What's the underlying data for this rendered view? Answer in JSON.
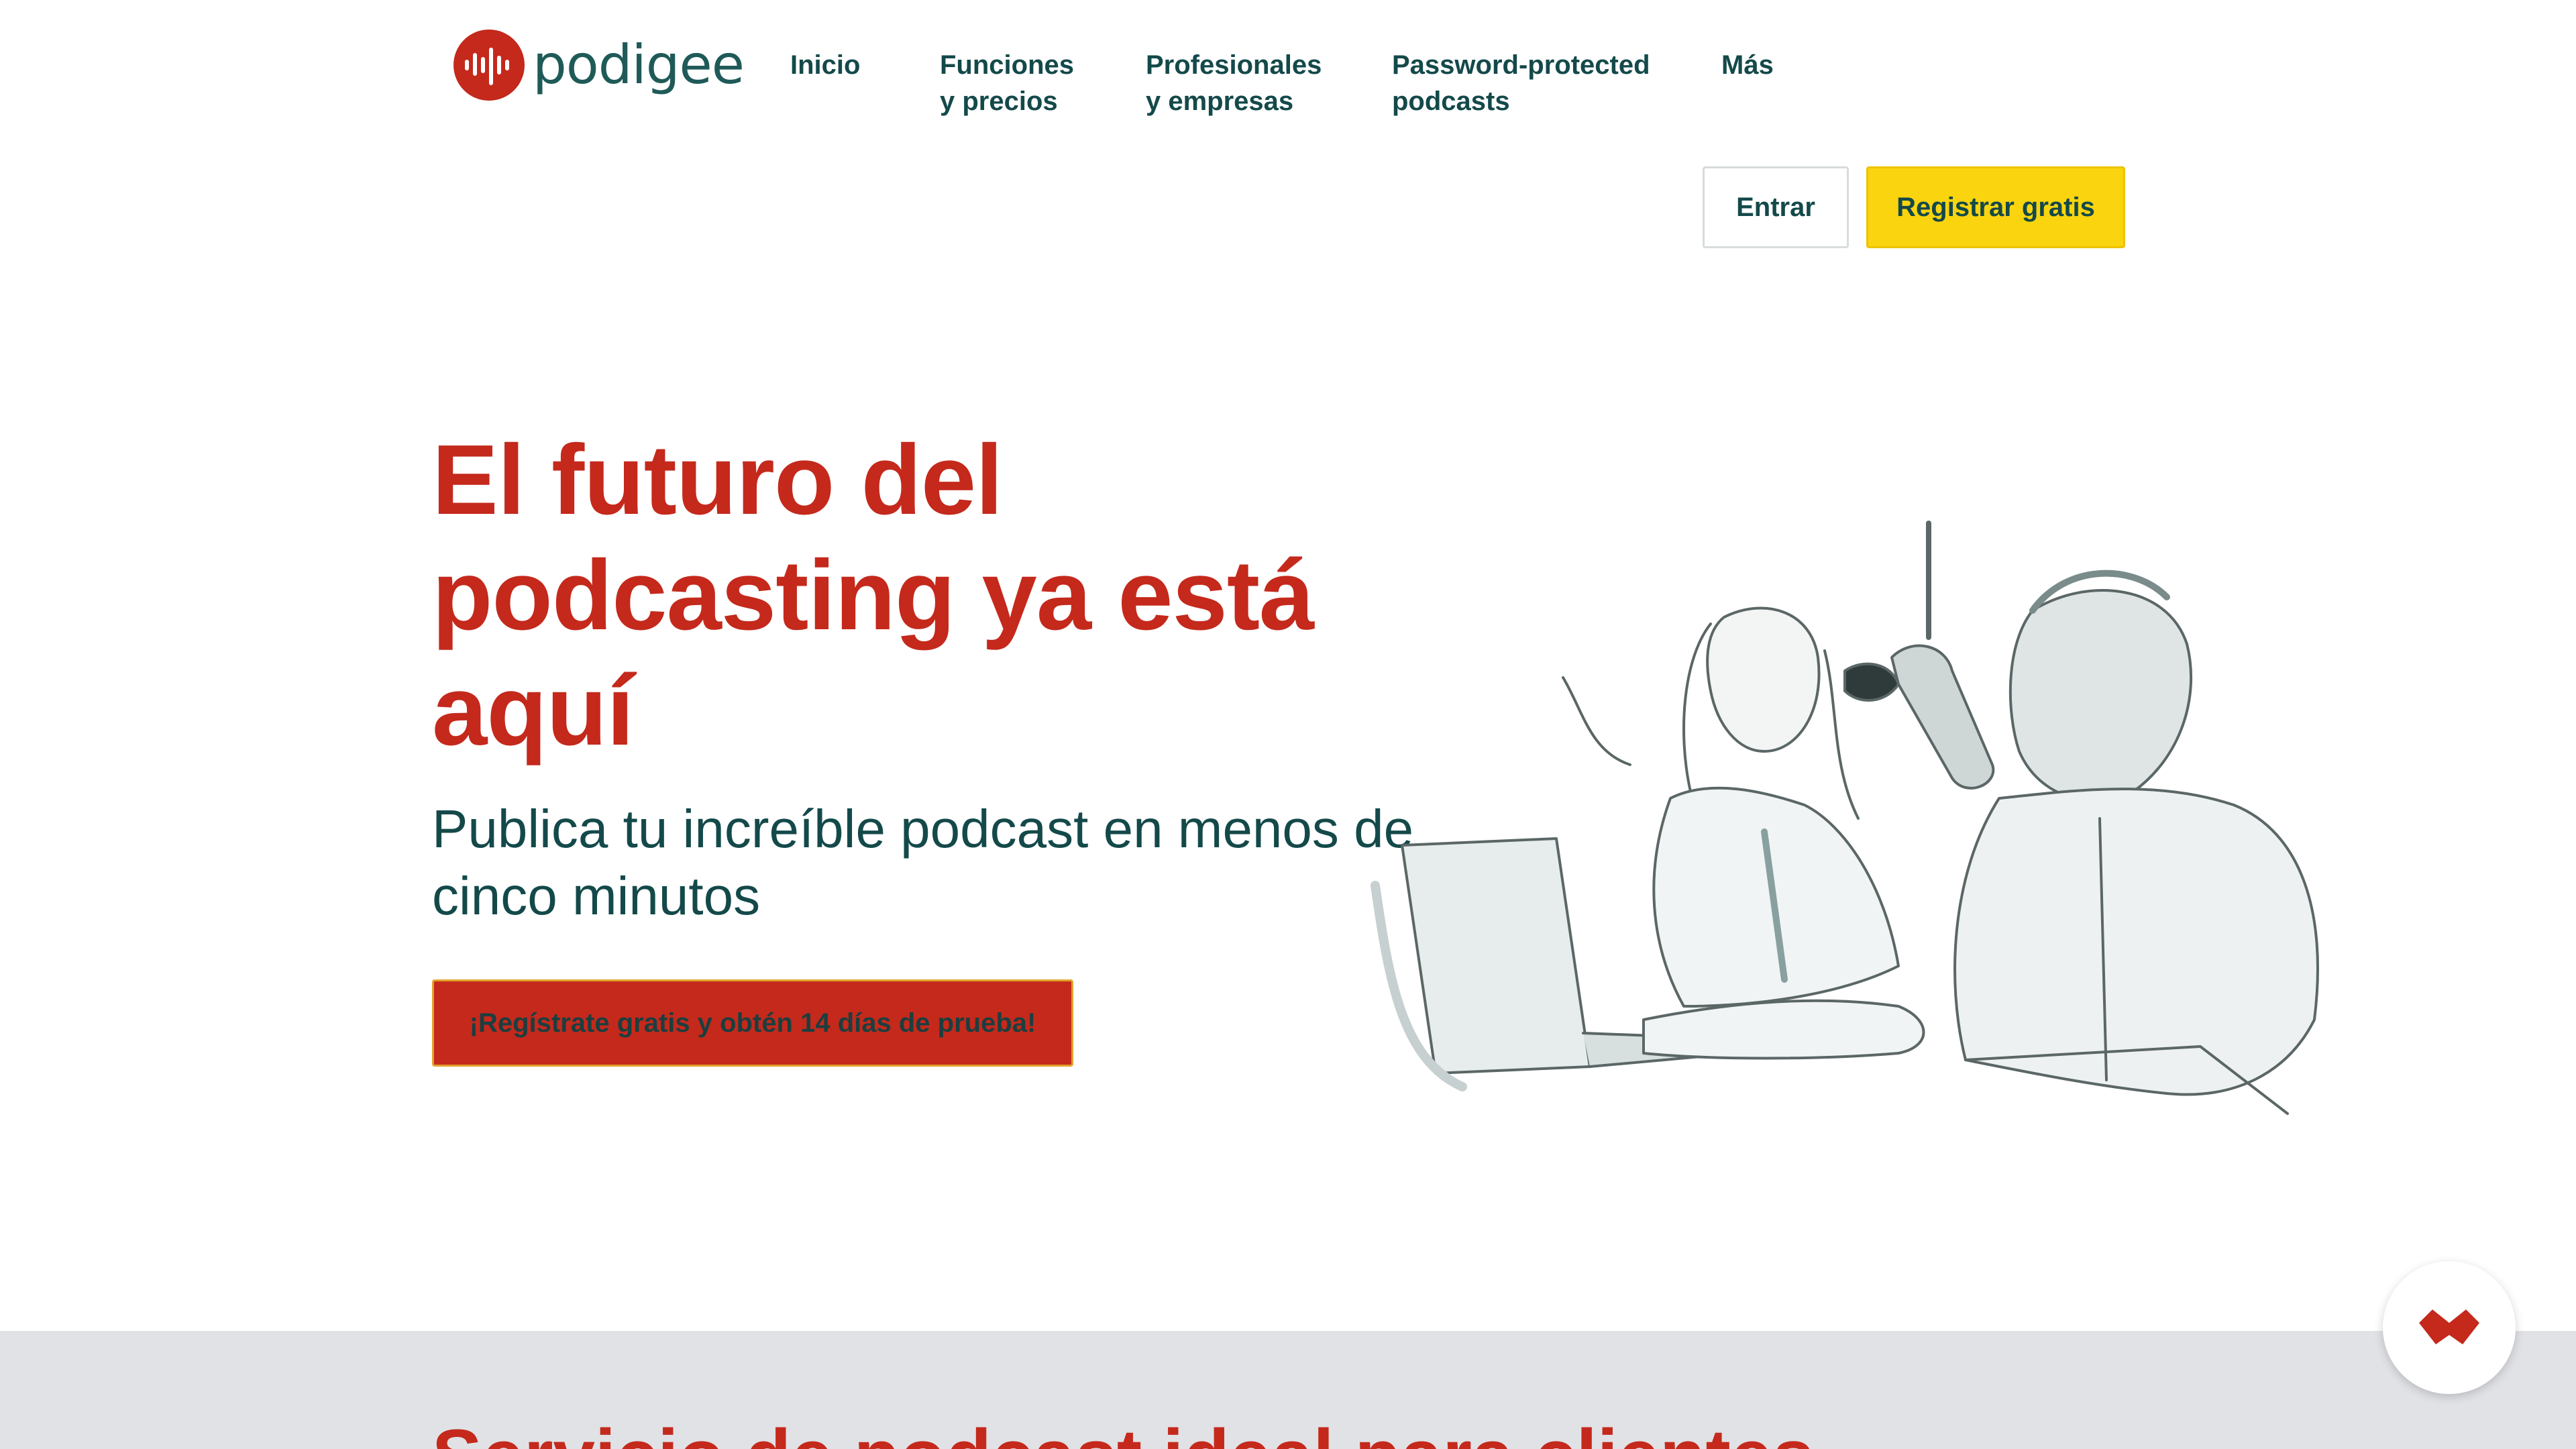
{
  "brand": {
    "name": "podigee",
    "logo_icon": "waveform-icon",
    "accent": "#c4291c"
  },
  "nav": {
    "items": [
      {
        "label": "Inicio"
      },
      {
        "label": "Funciones\ny precios"
      },
      {
        "label": "Profesionales\ny empresas"
      },
      {
        "label": "Password-protected\npodcasts"
      },
      {
        "label": "Más"
      }
    ]
  },
  "auth": {
    "login_label": "Entrar",
    "register_label": "Registrar gratis"
  },
  "hero": {
    "title": "El futuro del podcasting ya está aquí",
    "subtitle": "Publica tu increíble podcast en menos de cinco minutos",
    "cta_label": "¡Regístrate gratis y obtén 14 días de prueba!",
    "illustration": "podcast-hosts-illustration"
  },
  "section": {
    "title_partial": "Servicio de podcast ideal para clientes"
  },
  "floating": {
    "icon": "chat-widget-icon"
  },
  "colors": {
    "red": "#c4291c",
    "teal": "#14494a",
    "yellow": "#fad40e",
    "band": "#e0e2e6"
  }
}
